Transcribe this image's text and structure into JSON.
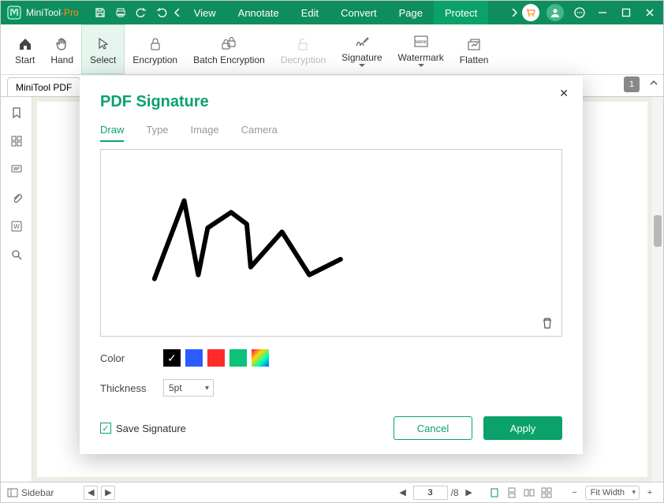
{
  "app": {
    "name_main": "MiniTool",
    "name_sep": "-",
    "name_suffix": "Pro"
  },
  "menu": {
    "view": "View",
    "annotate": "Annotate",
    "edit": "Edit",
    "convert": "Convert",
    "page": "Page",
    "protect": "Protect"
  },
  "ribbon": {
    "start": "Start",
    "hand": "Hand",
    "select": "Select",
    "encryption": "Encryption",
    "batch": "Batch Encryption",
    "decryption": "Decryption",
    "signature": "Signature",
    "watermark": "Watermark",
    "flatten": "Flatten"
  },
  "doc": {
    "tab_label": "MiniTool PDF",
    "page_badge": "1"
  },
  "modal": {
    "title": "PDF Signature",
    "tabs": {
      "draw": "Draw",
      "type": "Type",
      "image": "Image",
      "camera": "Camera"
    },
    "color_label": "Color",
    "thickness_label": "Thickness",
    "thickness_value": "5pt",
    "save_label": "Save Signature",
    "cancel": "Cancel",
    "apply": "Apply",
    "swatch_selected": "black"
  },
  "status": {
    "sidebar": "Sidebar",
    "current_page": "3",
    "total_pages": "/8",
    "zoom_mode": "Fit Width"
  }
}
